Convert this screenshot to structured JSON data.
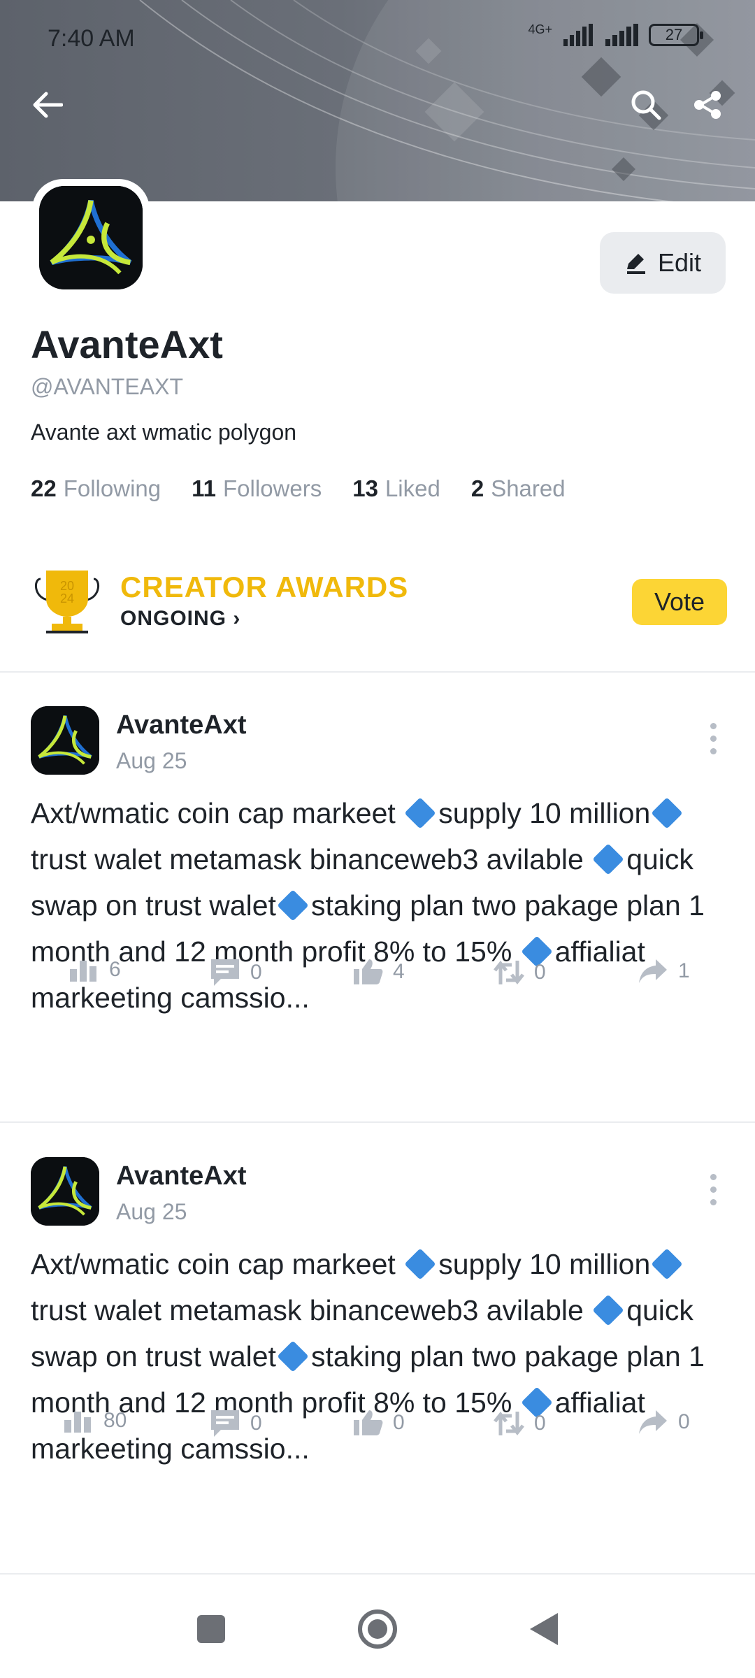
{
  "status_bar": {
    "time": "7:40 AM",
    "network": "4G+",
    "battery": "27"
  },
  "profile": {
    "edit_label": "Edit",
    "name": "AvanteAxt",
    "handle": "@AVANTEAXT",
    "bio": "Avante axt wmatic polygon",
    "stats": [
      {
        "count": "22",
        "label": "Following"
      },
      {
        "count": "11",
        "label": "Followers"
      },
      {
        "count": "13",
        "label": "Liked"
      },
      {
        "count": "2",
        "label": "Shared"
      }
    ]
  },
  "awards": {
    "title": "CREATOR AWARDS",
    "subtitle": "ONGOING ›",
    "trophy_year_top": "20",
    "trophy_year_bottom": "24",
    "vote_label": "Vote"
  },
  "posts": [
    {
      "author": "AvanteAxt",
      "date": "Aug 25",
      "segments": [
        "Axt/wmatic   coin cap markeet ",
        "supply 10 million",
        "trust walet metamask binanceweb3 avilable ",
        "quick swap on trust walet",
        "staking plan two pakage plan 1 month and 12 month profit 8% to 15% ",
        "affialiat markeeting camssio..."
      ],
      "views": "6",
      "comments": "0",
      "likes": "4",
      "reposts": "0",
      "shares": "1"
    },
    {
      "author": "AvanteAxt",
      "date": "Aug 25",
      "segments": [
        "Axt/wmatic   coin cap markeet ",
        "supply 10 million",
        "trust walet metamask binanceweb3 avilable ",
        "quick swap on trust walet",
        "staking plan two pakage plan 1 month and 12 month profit 8% to 15% ",
        "affialiat markeeting camssio..."
      ],
      "views": "80",
      "comments": "0",
      "likes": "0",
      "reposts": "0",
      "shares": "0"
    }
  ],
  "icons": {
    "back": "arrow-left-icon",
    "search": "search-icon",
    "share": "share-icon",
    "edit": "pencil-icon",
    "views": "bar-chart-icon",
    "comments": "comment-icon",
    "likes": "thumbs-up-icon",
    "reposts": "repost-icon",
    "shares": "forward-icon"
  },
  "colors": {
    "accent": "#f0b90b",
    "vote_bg": "#fcd535",
    "muted": "#929aa5",
    "diamond": "#3a8ce0"
  }
}
